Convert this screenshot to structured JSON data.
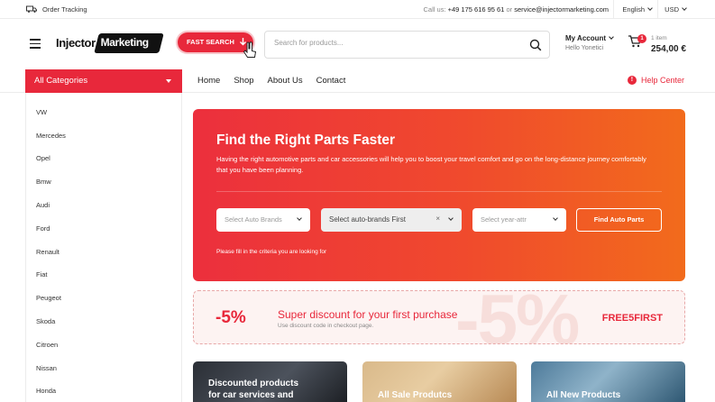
{
  "topbar": {
    "order_tracking": "Order Tracking",
    "contact_prefix": "Call us:",
    "phone": "+49 175 616 95 61",
    "contact_or": "or",
    "email": "service@injectormarketing.com",
    "language": "English",
    "currency": "USD"
  },
  "header": {
    "logo_part1": "Injector",
    "logo_part2": "Marketing",
    "fast_search_label": "FAST SEARCH",
    "search_placeholder": "Search for products...",
    "account_title": "My Account",
    "account_user": "Hello Yonetici",
    "cart_count": "1",
    "cart_items": "1 item",
    "cart_total": "254,00 €"
  },
  "nav": {
    "all_categories": "All Categories",
    "items": [
      "Home",
      "Shop",
      "About Us",
      "Contact"
    ],
    "help_center": "Help Center"
  },
  "sidebar": {
    "categories": [
      "VW",
      "Mercedes",
      "Opel",
      "Bmw",
      "Audi",
      "Ford",
      "Renault",
      "Fiat",
      "Peugeot",
      "Skoda",
      "Citroen",
      "Nissan",
      "Honda"
    ]
  },
  "hero": {
    "title": "Find the Right Parts Faster",
    "description": "Having the right automotive parts and car accessories will help you to boost your travel comfort and go on the long-distance journey comfortably that you have been planning.",
    "select_brand_placeholder": "Select Auto Brands",
    "select_model_placeholder": "Select auto-brands First",
    "select_year_placeholder": "Select year-attr",
    "find_button": "Find Auto Parts",
    "note": "Please fill in the criteria you are looking for"
  },
  "discount": {
    "percent": "-5%",
    "background_text": "-5%",
    "headline": "Super discount for your first purchase",
    "subtext": "Use discount code in checkout page.",
    "code": "FREE5FIRST"
  },
  "cards": [
    {
      "line1": "Discounted products",
      "line2": "for car services and"
    },
    {
      "line1": "All Sale Produtcs"
    },
    {
      "line1": "All New Products"
    }
  ],
  "colors": {
    "accent": "#e8283b",
    "hero_start": "#ec2f3d",
    "hero_end": "#f26b1c"
  },
  "icons": [
    "truck-icon",
    "arrow-icon",
    "cursor-icon",
    "search-icon",
    "cart-icon",
    "info-icon",
    "menu-icon"
  ]
}
